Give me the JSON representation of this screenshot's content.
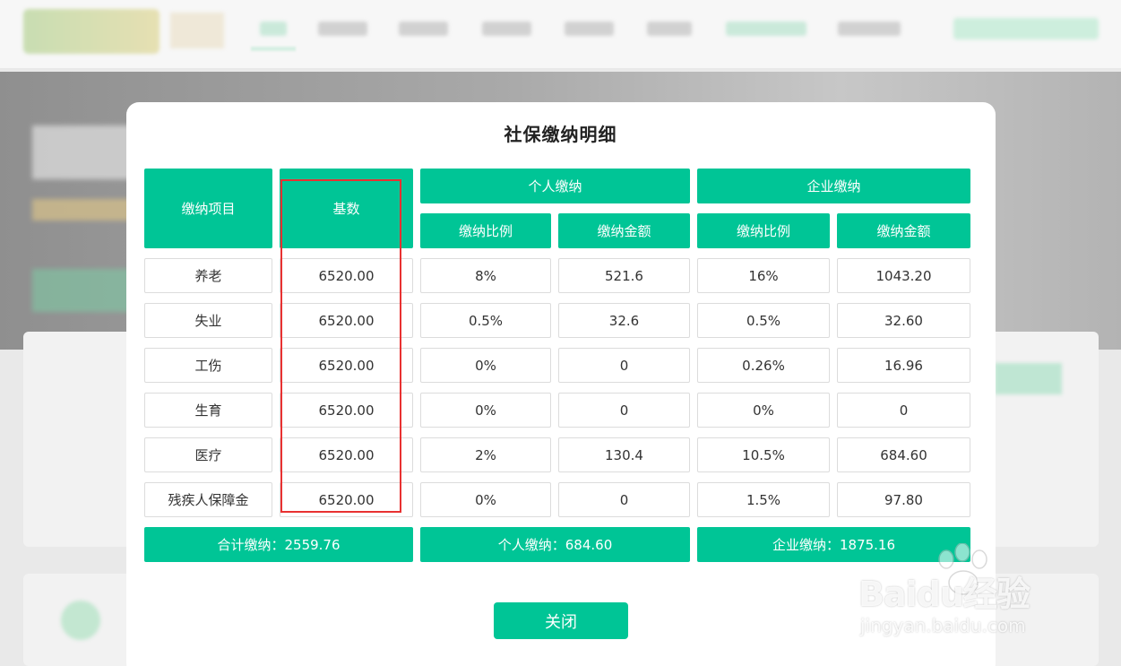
{
  "modal": {
    "title": "社保缴纳明细",
    "headers": {
      "item": "缴纳项目",
      "base": "基数",
      "personal": "个人缴纳",
      "company": "企业缴纳",
      "personal_rate": "缴纳比例",
      "personal_amount": "缴纳金额",
      "company_rate": "缴纳比例",
      "company_amount": "缴纳金额"
    },
    "rows": [
      {
        "item": "养老",
        "base": "6520.00",
        "p_rate": "8%",
        "p_amount": "521.6",
        "c_rate": "16%",
        "c_amount": "1043.20"
      },
      {
        "item": "失业",
        "base": "6520.00",
        "p_rate": "0.5%",
        "p_amount": "32.6",
        "c_rate": "0.5%",
        "c_amount": "32.60"
      },
      {
        "item": "工伤",
        "base": "6520.00",
        "p_rate": "0%",
        "p_amount": "0",
        "c_rate": "0.26%",
        "c_amount": "16.96"
      },
      {
        "item": "生育",
        "base": "6520.00",
        "p_rate": "0%",
        "p_amount": "0",
        "c_rate": "0%",
        "c_amount": "0"
      },
      {
        "item": "医疗",
        "base": "6520.00",
        "p_rate": "2%",
        "p_amount": "130.4",
        "c_rate": "10.5%",
        "c_amount": "684.60"
      },
      {
        "item": "残疾人保障金",
        "base": "6520.00",
        "p_rate": "0%",
        "p_amount": "0",
        "c_rate": "1.5%",
        "c_amount": "97.80"
      }
    ],
    "totals": {
      "total": "合计缴纳：2559.76",
      "personal": "个人缴纳：684.60",
      "company": "企业缴纳：1875.16"
    },
    "close_label": "关闭"
  },
  "watermark": {
    "brand": "Baidu经验",
    "url": "jingyan.baidu.com"
  },
  "colors": {
    "accent": "#00c596",
    "highlight": "#e83131"
  }
}
